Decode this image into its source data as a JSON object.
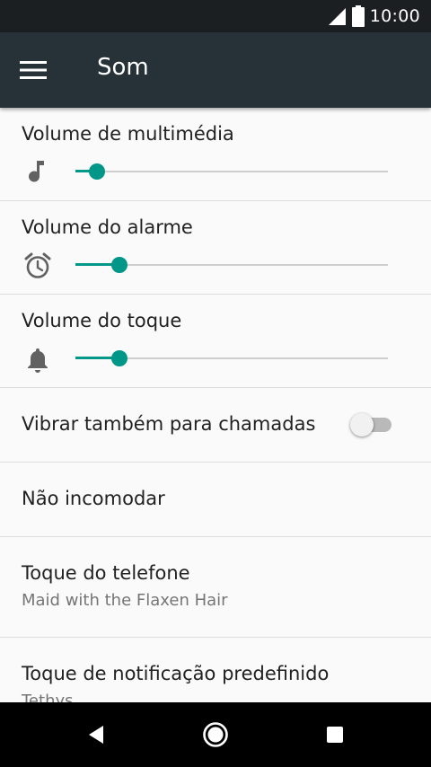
{
  "status_bar": {
    "time": "10:00",
    "icons": [
      "signal-icon",
      "battery-icon"
    ]
  },
  "app_bar": {
    "title": "Som",
    "menu_icon": "menu-icon"
  },
  "settings": {
    "media_volume": {
      "title": "Volume de multimédia",
      "icon": "music-note-icon",
      "level": 0.07
    },
    "alarm_volume": {
      "title": "Volume do alarme",
      "icon": "alarm-clock-icon",
      "level": 0.14
    },
    "ring_volume": {
      "title": "Volume do toque",
      "icon": "bell-icon",
      "level": 0.14
    },
    "vibrate": {
      "title": "Vibrar também para chamadas",
      "enabled": false
    },
    "dnd": {
      "title": "Não incomodar"
    },
    "ringtone": {
      "title": "Toque do telefone",
      "subtitle": "Maid with the Flaxen Hair"
    },
    "notification": {
      "title": "Toque de notificação predefinido",
      "subtitle": "Tethys"
    }
  },
  "nav_bar": {
    "icons": [
      "back-icon",
      "home-icon",
      "recents-icon"
    ]
  },
  "colors": {
    "accent": "#009688",
    "app_bar": "#263238",
    "status_bar": "#1b1f22",
    "background": "#fafafa"
  }
}
